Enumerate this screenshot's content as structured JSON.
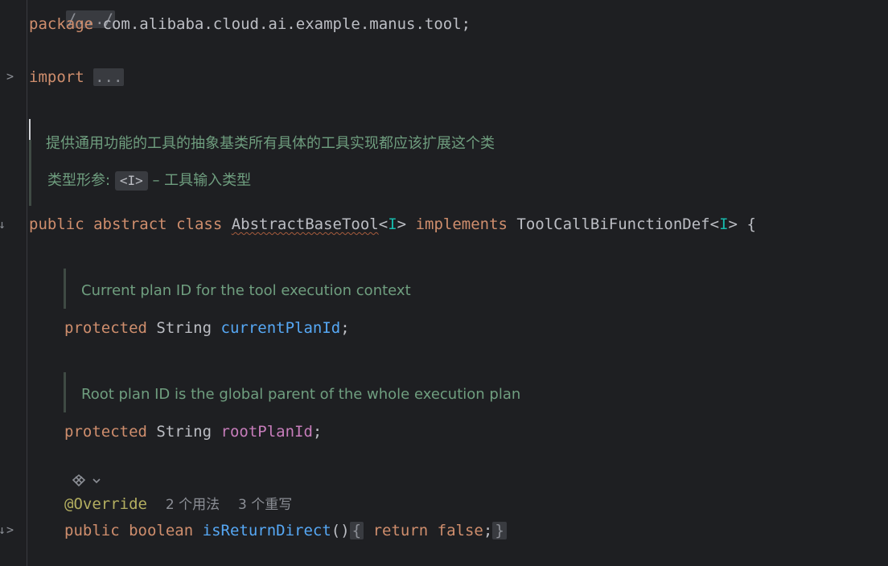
{
  "lines": {
    "header_fold": "/.../",
    "package_kw": "package",
    "package_name": "com.alibaba.cloud.ai.example.manus.tool;",
    "import_kw": "import",
    "import_fold": "...",
    "doc_class": "提供通用功能的工具的抽象基类所有具体的工具实现都应该扩展这个类",
    "doc_param_label": "类型形参:",
    "doc_param_chip": "<I>",
    "doc_param_desc": "– 工具输入类型",
    "class_kw_public": "public",
    "class_kw_abstract": "abstract",
    "class_kw_class": "class",
    "class_name": "AbstractBaseTool",
    "class_tp_open": "<",
    "class_tp": "I",
    "class_tp_close": ">",
    "class_implements": "implements",
    "class_iface": "ToolCallBiFunctionDef",
    "class_iface_tp_open": "<",
    "class_iface_tp": "I",
    "class_iface_tp_close": ">",
    "class_brace": "{",
    "doc_field1": "Current plan ID for the tool execution context",
    "field1_kw": "protected",
    "field1_type": "String",
    "field1_name": "currentPlanId",
    "field1_semi": ";",
    "doc_field2": "Root plan ID is the global parent of the whole execution plan",
    "field2_kw": "protected",
    "field2_type": "String",
    "field2_name": "rootPlanId",
    "field2_semi": ";",
    "override_anno": "@Override",
    "usages_hint": "2 个用法",
    "overrides_hint": "3 个重写",
    "method_kw_public": "public",
    "method_kw_boolean": "boolean",
    "method_name": "isReturnDirect",
    "method_parens": "()",
    "method_body_open": "{",
    "method_return": "return",
    "method_false": "false",
    "method_semi": ";",
    "method_body_close": "}"
  },
  "gutter": {
    "fold_icon_import": ">",
    "fold_icon_method": ">",
    "impl_icon_class": "↓",
    "impl_icon_method": "↓"
  },
  "colors": {
    "background": "#1e1f22",
    "keyword": "#cf8e6d",
    "type_param": "#16baac",
    "field_blue": "#56a8f5",
    "field_pink": "#c77dbb",
    "annotation": "#b3ae60",
    "doc_comment": "#6f9e7f"
  }
}
